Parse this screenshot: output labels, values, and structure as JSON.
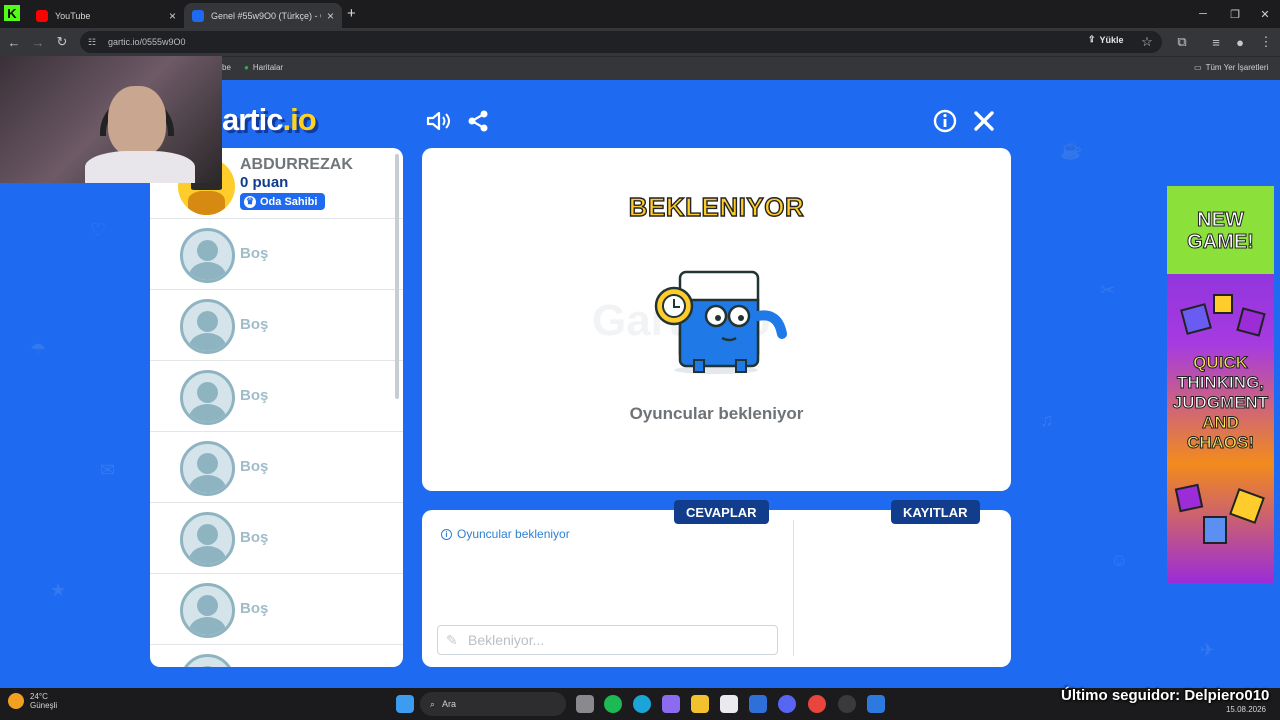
{
  "browser": {
    "tabs": [
      {
        "title": "YouTube",
        "active": false
      },
      {
        "title": "Genel #55w9O0 (Türkçe) - Garti",
        "active": true
      }
    ],
    "url": "gartic.io/0555w9O0",
    "upload_label": "Yükle",
    "bookmarks": [
      {
        "label": "be"
      },
      {
        "label": "Haritalar"
      }
    ],
    "all_bookmarks_label": "Tüm Yer İşaretleri"
  },
  "game": {
    "logo_main": "artic",
    "logo_accent": ".io",
    "host": {
      "name": "ABDURREZAK",
      "points": "0 puan",
      "badge": "Oda Sahibi"
    },
    "empty_slot_label": "Boş",
    "stage": {
      "title": "BEKLENIYOR",
      "subtitle": "Oyuncular bekleniyor",
      "watermark": "Gartic.io"
    },
    "tabs": {
      "answers": "CEVAPLAR",
      "logs": "KAYITLAR"
    },
    "chat_message": "Oyuncular bekleniyor",
    "answer_placeholder": "Bekleniyor..."
  },
  "ad": {
    "line1": "NEW",
    "line2": "GAME!",
    "line3": "QUICK",
    "line4": "THINKING,",
    "line5": "JUDGMENT",
    "line6": "AND",
    "line7": "CHAOS!"
  },
  "taskbar": {
    "weather_temp": "24°C",
    "weather_desc": "Güneşli",
    "search_label": "Ara",
    "date": "15.08.2026",
    "overlay_follower": "Último seguidor: Delpiero010"
  },
  "colors": {
    "page_bg": "#1e6af0",
    "brand_yellow": "#ffcd2b",
    "navy": "#123c8c"
  }
}
